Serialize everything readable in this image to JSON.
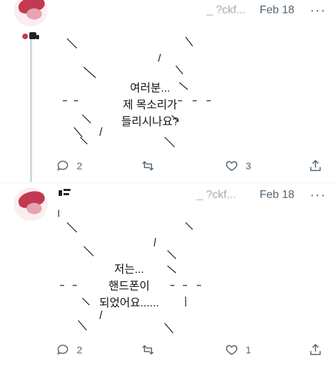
{
  "tweets": [
    {
      "handle": "_ ?ckf...",
      "date": "Feb 18",
      "more": "···",
      "text_lines": [
        "여러분...",
        "제 목소리가",
        "들리시나요?"
      ],
      "reply_count": "2",
      "like_count": "3"
    },
    {
      "handle": "_ ?ckf...",
      "date": "Feb 18",
      "more": "···",
      "text_lines": [
        "저는...",
        "핸드폰이",
        "되었어요......"
      ],
      "reply_count": "2",
      "like_count": "1"
    }
  ],
  "icons": {
    "reply": "reply-icon",
    "retweet": "retweet-icon",
    "like": "heart-icon",
    "share": "share-icon"
  },
  "colors": {
    "avatar_accent": "#c23a52",
    "muted_text": "#536471",
    "thread_line": "#cfd9de"
  }
}
